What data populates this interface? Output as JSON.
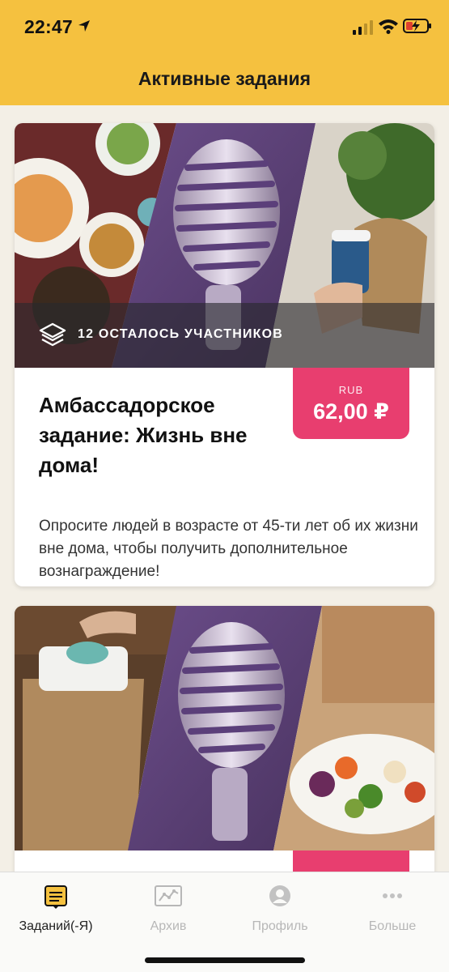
{
  "status_bar": {
    "time": "22:47",
    "icons": [
      "location-arrow-icon",
      "cellular-signal-icon",
      "wifi-icon",
      "battery-charging-icon"
    ]
  },
  "header": {
    "title": "Активные задания"
  },
  "colors": {
    "header_bg": "#f5c13f",
    "price_badge": "#e83e6f",
    "page_bg": "#f3efe6",
    "tab_inactive": "#b7b7b7"
  },
  "cards": [
    {
      "participants": "12 ОСТАЛОСЬ УЧАСТНИКОВ",
      "price_currency": "RUB",
      "price": "62,00 ₽",
      "title": "Амбассадорское задание: Жизнь вне дома!",
      "description": "Опросите людей в возрасте от 45-ти лет об их жизни вне дома, чтобы получить дополнительное вознаграждение!"
    }
  ],
  "tabs": [
    {
      "label": "Заданий(-Я)",
      "icon": "tasks-icon",
      "active": true
    },
    {
      "label": "Архив",
      "icon": "archive-chart-icon",
      "active": false
    },
    {
      "label": "Профиль",
      "icon": "profile-icon",
      "active": false
    },
    {
      "label": "Больше",
      "icon": "more-dots-icon",
      "active": false
    }
  ]
}
